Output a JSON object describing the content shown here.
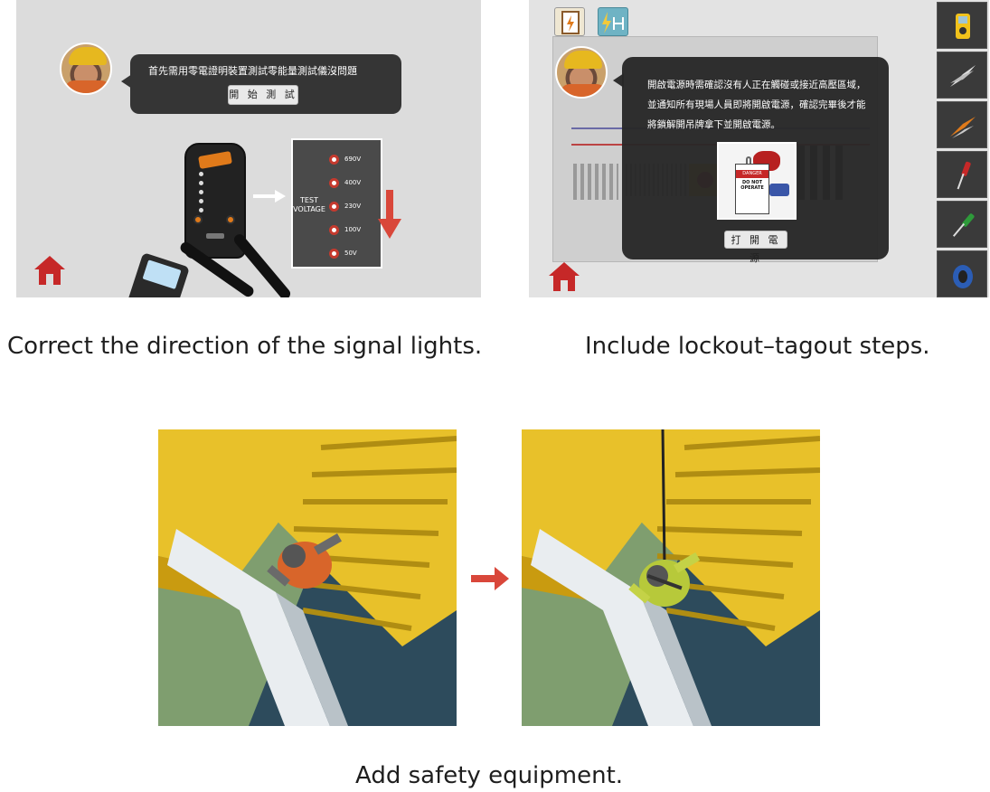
{
  "panel_voltage": {
    "speech": "首先需用零電證明裝置測試零能量測試儀沒問題",
    "start_button": "開 始 測 試",
    "test_voltage_label": "TEST\nVOLTAGE",
    "voltage_levels": [
      "690V",
      "400V",
      "230V",
      "100V",
      "50V"
    ],
    "caption": "Correct the direction of the signal lights."
  },
  "panel_lockout": {
    "speech_lines": [
      "開啟電源時需確認沒有人正在觸碰或接近高壓區域，",
      "並通知所有現場人員即將開啟電源，確認完畢後才能",
      "將鎖解開吊牌拿下並開啟電源。"
    ],
    "tag_header": "DANGER",
    "tag_text": "DO NOT OPERATE",
    "power_button": "打 開 電 源",
    "tools": [
      "multimeter-icon",
      "wire-stripper-icon",
      "crimper-icon",
      "screwdriver-red-icon",
      "screwdriver-green-icon",
      "cable-reel-icon"
    ],
    "caption": "Include lockout–tagout steps."
  },
  "panel_safety": {
    "caption": "Add safety equipment."
  },
  "colors": {
    "home_red": "#c62828",
    "arrow_red": "#d9473a",
    "bubble_dark": "#353535",
    "ladder_yellow": "#e8c12a"
  }
}
